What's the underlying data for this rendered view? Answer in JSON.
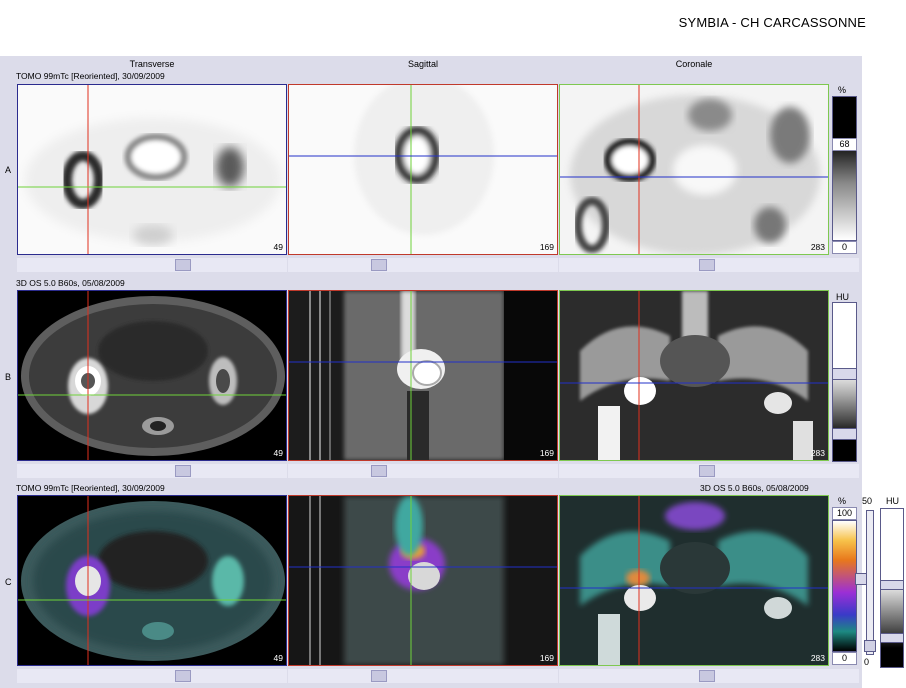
{
  "app_title": "SYMBIA - CH CARCASSONNE",
  "columns": [
    "Transverse",
    "Sagittal",
    "Coronale"
  ],
  "rows": {
    "a": {
      "letter": "A",
      "series": "TOMO 99mTc [Reoriented], 30/09/2009"
    },
    "b": {
      "letter": "B",
      "series": "3D  OS  5.0  B60s, 05/08/2009"
    },
    "c": {
      "letter": "C",
      "series_left": "TOMO 99mTc [Reoriented], 30/09/2009",
      "series_right": "3D  OS  5.0  B60s, 05/08/2009"
    }
  },
  "slice_numbers": {
    "transverse": "49",
    "sagittal": "169",
    "coronal": "283"
  },
  "colorbar_a": {
    "unit": "%",
    "level": "68",
    "min": "0"
  },
  "colorbar_b": {
    "unit": "HU"
  },
  "colorbar_c": {
    "unit": "%",
    "max": "100",
    "min": "0",
    "blend": "50",
    "blend_min": "0",
    "ct_unit": "HU"
  },
  "colors": {
    "transverse_border": "#2b2b8e",
    "sagittal_border": "#c0392b",
    "coronal_border": "#7ec850",
    "crosshair_red": "#e0301e",
    "crosshair_green": "#6fd23a",
    "crosshair_blue": "#2230c8"
  }
}
